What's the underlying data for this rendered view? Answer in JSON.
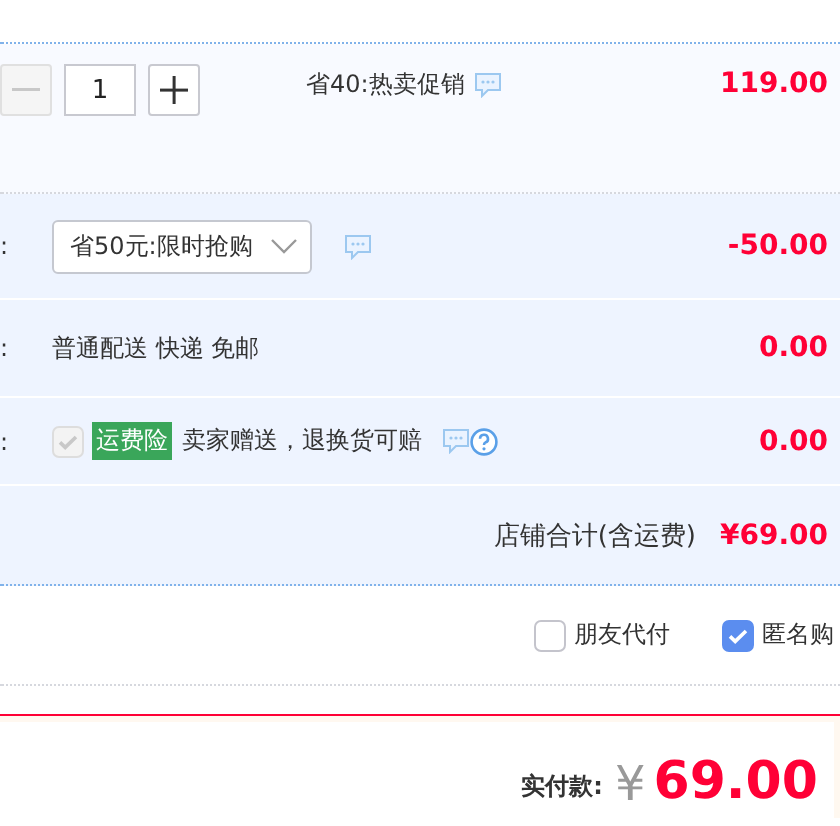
{
  "item": {
    "quantity": "1",
    "decrease_disabled": true,
    "promotion": "省40:热卖促销",
    "price": "119.00"
  },
  "discount": {
    "label_tail": ":",
    "selected_option": "省50元:限时抢购",
    "amount": "-50.00"
  },
  "delivery": {
    "label_tail": ":",
    "method": "普通配送 快递 免邮",
    "amount": "0.00"
  },
  "insurance": {
    "label_tail": ":",
    "checked": true,
    "disabled": true,
    "badge": "运费险",
    "description": "卖家赠送，退换货可赔",
    "amount": "0.00"
  },
  "store_total": {
    "label": "店铺合计(含运费)",
    "amount": "¥69.00"
  },
  "options": [
    {
      "label": "朋友代付",
      "checked": false
    },
    {
      "label": "匿名购",
      "checked": true
    }
  ],
  "payment": {
    "label": "实付款:",
    "currency": "¥",
    "amount": "69.00"
  }
}
